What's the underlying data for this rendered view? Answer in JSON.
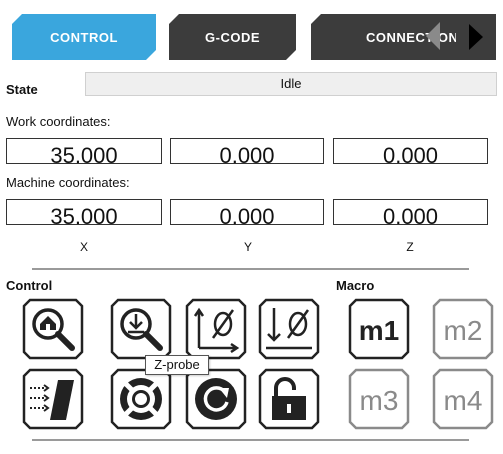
{
  "tabs": [
    {
      "label": "CONTROL",
      "active": true
    },
    {
      "label": "G-CODE",
      "active": false
    },
    {
      "label": "CONNECTION",
      "active": false
    }
  ],
  "colors": {
    "accent": "#3aa6dd",
    "tab_inactive": "#3c3c3c",
    "disabled": "#8a8a8a"
  },
  "state": {
    "label": "State",
    "value": "Idle"
  },
  "work": {
    "label": "Work coordinates:",
    "x": "35.000",
    "y": "0.000",
    "z": "0.000"
  },
  "machine": {
    "label": "Machine coordinates:",
    "x": "35.000",
    "y": "0.000",
    "z": "0.000"
  },
  "axes": {
    "x": "X",
    "y": "Y",
    "z": "Z"
  },
  "control": {
    "label": "Control",
    "buttons": [
      {
        "icon": "home-search-icon"
      },
      {
        "icon": "z-probe-icon"
      },
      {
        "icon": "zero-xy-icon"
      },
      {
        "icon": "zero-z-icon"
      },
      {
        "icon": "feed-hold-icon"
      },
      {
        "icon": "lifebuoy-icon"
      },
      {
        "icon": "reset-icon"
      },
      {
        "icon": "unlock-icon"
      }
    ]
  },
  "macro": {
    "label": "Macro",
    "buttons": [
      {
        "label": "m1",
        "enabled": true
      },
      {
        "label": "m2",
        "enabled": false
      },
      {
        "label": "m3",
        "enabled": false
      },
      {
        "label": "m4",
        "enabled": false
      }
    ]
  },
  "tooltip": "Z-probe"
}
